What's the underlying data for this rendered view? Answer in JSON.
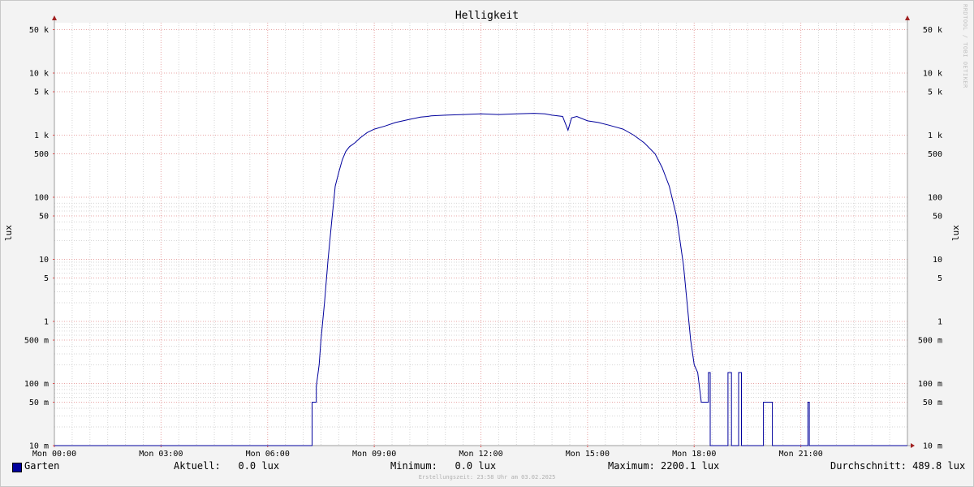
{
  "chart_data": {
    "type": "line",
    "title": "Helligkeit",
    "ylabel": "lux",
    "ylabel_right": "lux",
    "yscale": "log",
    "ylim": [
      10,
      80000
    ],
    "y_ticks": [
      {
        "value": 10,
        "label": "10 m"
      },
      {
        "value": 50,
        "label": "50 m"
      },
      {
        "value": 100,
        "label": "100 m"
      },
      {
        "value": 500,
        "label": "500 m"
      },
      {
        "value": 1000,
        "label": "1"
      },
      {
        "value": 5000,
        "label": "5"
      },
      {
        "value": 10000,
        "label": "10"
      },
      {
        "value": 50000,
        "label": "50"
      },
      {
        "value": 100000,
        "label": "100"
      },
      {
        "value": 500000,
        "label": "500"
      },
      {
        "value": 1000000,
        "label": "1 k"
      },
      {
        "value": 5000000,
        "label": "5 k"
      },
      {
        "value": 10000000,
        "label": "10 k"
      },
      {
        "value": 50000000,
        "label": "50 k"
      }
    ],
    "x_unit": "hours",
    "xlim": [
      0,
      24
    ],
    "x_ticks": [
      {
        "value": 0,
        "label": "Mon 00:00"
      },
      {
        "value": 3,
        "label": "Mon 03:00"
      },
      {
        "value": 6,
        "label": "Mon 06:00"
      },
      {
        "value": 9,
        "label": "Mon 09:00"
      },
      {
        "value": 12,
        "label": "Mon 12:00"
      },
      {
        "value": 15,
        "label": "Mon 15:00"
      },
      {
        "value": 18,
        "label": "Mon 18:00"
      },
      {
        "value": 21,
        "label": "Mon 21:00"
      }
    ],
    "grid": true,
    "series": [
      {
        "name": "Garten",
        "color": "#00009c",
        "x": [
          0,
          7.25,
          7.25,
          7.37,
          7.37,
          7.45,
          7.5,
          7.6,
          7.7,
          7.8,
          7.9,
          8.0,
          8.1,
          8.2,
          8.3,
          8.45,
          8.6,
          8.8,
          9.0,
          9.3,
          9.6,
          10.0,
          10.3,
          10.5,
          10.6,
          11.0,
          11.5,
          12.0,
          12.5,
          13.0,
          13.5,
          13.8,
          14.0,
          14.3,
          14.45,
          14.55,
          14.7,
          15.0,
          15.3,
          15.6,
          16.0,
          16.3,
          16.6,
          16.9,
          17.1,
          17.3,
          17.5,
          17.7,
          17.8,
          17.9,
          18.0,
          18.1,
          18.2,
          18.22,
          18.4,
          18.4,
          18.45,
          18.45,
          18.5,
          18.5,
          18.95,
          18.95,
          19.05,
          19.05,
          19.25,
          19.25,
          19.33,
          19.33,
          19.95,
          19.95,
          20.2,
          20.2,
          21.2,
          21.2,
          21.24,
          21.24,
          24
        ],
        "y": [
          10,
          10,
          50,
          50,
          90,
          200,
          500,
          2000,
          10000,
          40000,
          150000,
          250000,
          400000,
          550000,
          650000,
          750000,
          900000,
          1100000,
          1250000,
          1400000,
          1600000,
          1800000,
          1950000,
          2000000,
          2050000,
          2100000,
          2150000,
          2200000,
          2150000,
          2200000,
          2250000,
          2200100,
          2100000,
          2000000,
          1200000,
          1900000,
          2000000,
          1700000,
          1600000,
          1450000,
          1250000,
          1000000,
          750000,
          500000,
          300000,
          150000,
          50000,
          8000,
          2000,
          500,
          200,
          150,
          50,
          50,
          50,
          150,
          150,
          10,
          10,
          10,
          10,
          150,
          150,
          10,
          10,
          150,
          150,
          10,
          10,
          50,
          50,
          10,
          10,
          50,
          50,
          10,
          10
        ]
      }
    ]
  },
  "legend": {
    "series_name": "Garten",
    "aktuell": "Aktuell:   0.0 lux",
    "minimum": "Minimum:   0.0 lux",
    "maximum": "Maximum: 2200.1 lux",
    "durchschnitt": "Durchschnitt: 489.8 lux"
  },
  "footer": "Erstellungszeit: 23:58 Uhr am 03.02.2025",
  "sidetext": "RRDTOOL / TOBI OETIKER"
}
